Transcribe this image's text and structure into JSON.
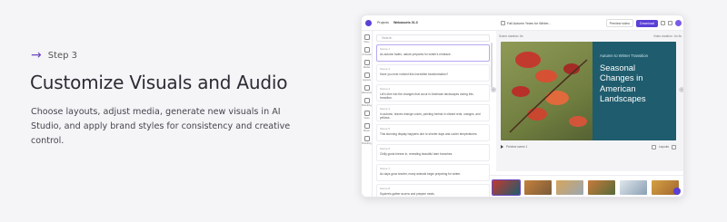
{
  "step": {
    "label": "Step 3"
  },
  "headline": "Customize Visuals and Audio",
  "description": "Choose layouts, adjust media, generate new visuals in AI Studio, and apply brand styles for consistency and creative control.",
  "app": {
    "breadcrumb": [
      "Projects",
      "Webassets 01.0"
    ],
    "doc_title": "Fall Autumn Years for Winter...",
    "preview_button": "Preview video",
    "download_button": "Download",
    "rail_items": [
      "Story",
      "AI Studio",
      "Media",
      "Layouts",
      "Elements",
      "Branding",
      "Voice",
      "Music",
      "Branding"
    ],
    "search_placeholder": "Search",
    "scenes": [
      {
        "num": "Scene 1",
        "text": "As autumn fades, nature prepares for winter's embrace."
      },
      {
        "num": "Scene 2",
        "text": "Have you ever noticed this incredible transformation?"
      },
      {
        "num": "Scene 3",
        "text": "Let's dive into the changes that occur in American landscapes during this transition."
      },
      {
        "num": "Scene 4",
        "text": "In autumn, leaves change colors, painting forests in vibrant reds, oranges, and yellows."
      },
      {
        "num": "Scene 5",
        "text": "This stunning display happens due to shorter days and cooler temperatures."
      },
      {
        "num": "Scene 6",
        "text": "Chilly gusts breeze in, revealing beautiful bare branches."
      },
      {
        "num": "Scene 7",
        "text": "As days grow shorter, many animals begin preparing for winter."
      },
      {
        "num": "Scene 8",
        "text": "Squirrels gather acorns and prepare nests."
      }
    ],
    "canvas": {
      "scene_duration": "Scene duration: 6s",
      "video_duration": "Video duration: 1m 6s",
      "slide_subtitle": "Autumn to Winter Transition",
      "slide_title": "Seasonal Changes in American Landscapes",
      "preview_label": "Preview scene 1",
      "layout_label": "Layouts"
    },
    "filmstrip_numbers": [
      "1",
      "2",
      "3",
      "4",
      "5",
      "6"
    ],
    "colors": {
      "accent": "#5b3fd6",
      "slide_panel": "#1f5c6e"
    }
  }
}
